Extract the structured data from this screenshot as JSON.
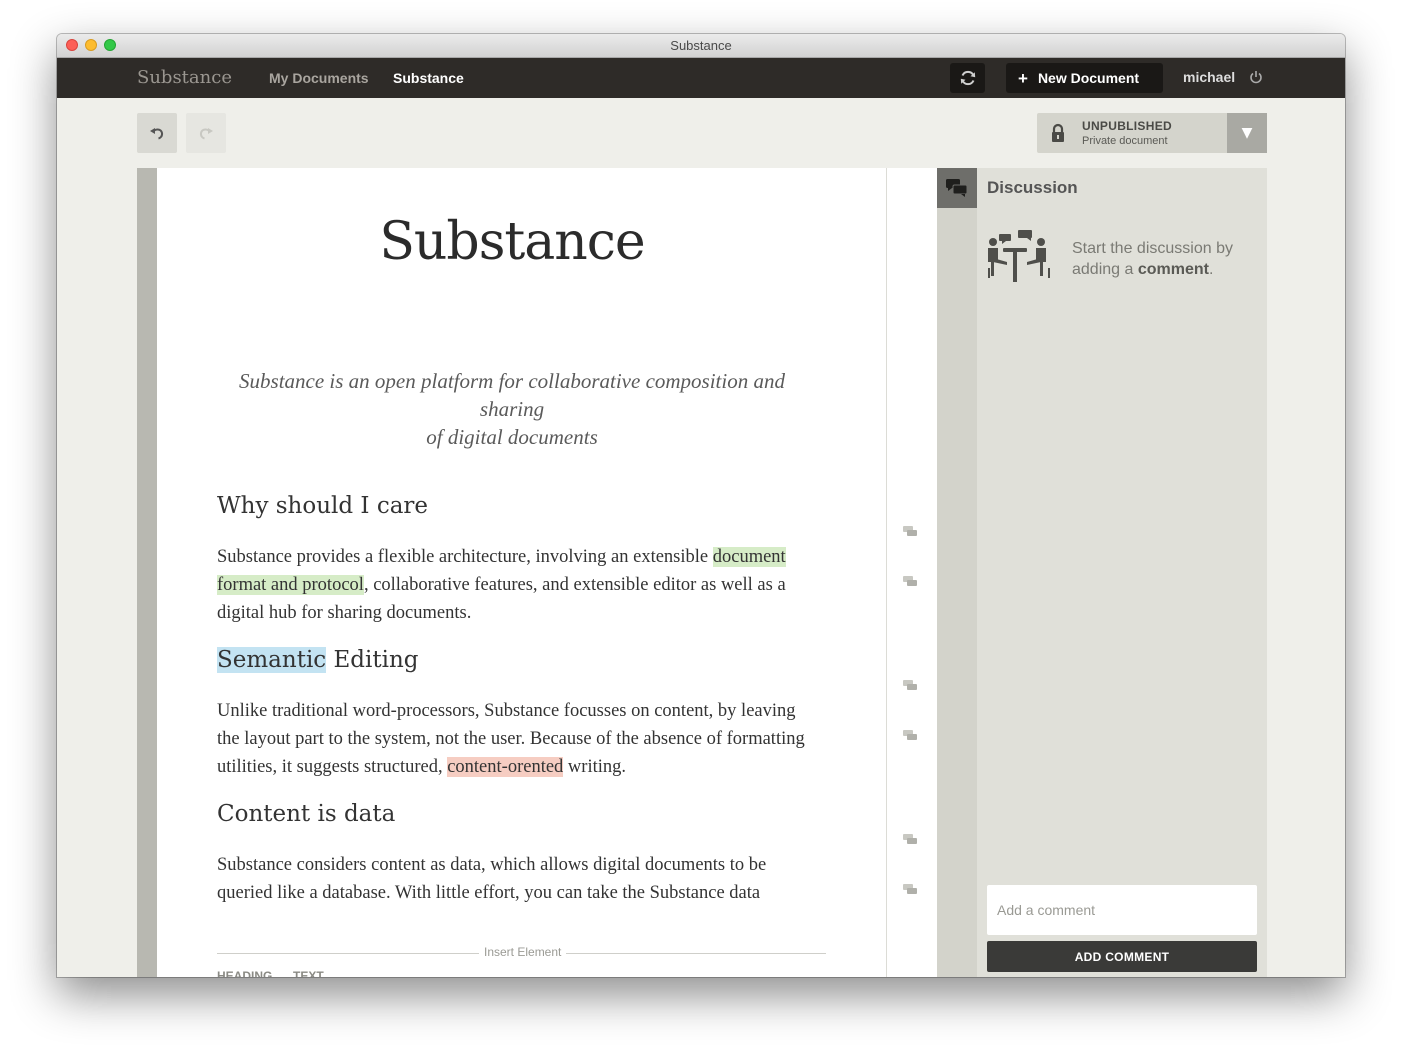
{
  "window": {
    "title": "Substance"
  },
  "nav": {
    "brand": "Substance",
    "links": [
      "My Documents",
      "Substance"
    ],
    "new_document": "New Document",
    "user": "michael"
  },
  "status": {
    "title": "UNPUBLISHED",
    "subtitle": "Private document"
  },
  "document": {
    "title": "Substance",
    "lead_line1": "Substance is an open platform for collaborative composition and sharing",
    "lead_line2": "of digital documents",
    "sections": [
      {
        "heading": "Why should I care",
        "para_before": "Substance provides a flexible architecture, involving an extensible ",
        "para_highlight": "document format and protocol",
        "para_after": ", collaborative features, and extensible editor as well as a digital hub for sharing documents."
      },
      {
        "heading_highlight": "Semantic",
        "heading_rest": " Editing",
        "para_before": "Unlike traditional word-processors, Substance focusses on content, by leaving the layout part to the system, not the user. Because of the absence of formatting utilities, it suggests structured, ",
        "para_highlight": "content-orented",
        "para_after": " writing."
      },
      {
        "heading": "Content is data",
        "para": "Substance considers content as data, which allows digital documents to be queried like a database. With little effort, you can take the Substance data"
      }
    ],
    "insert_element": "Insert Element",
    "insert_options": [
      "HEADING",
      "TEXT"
    ]
  },
  "discussion": {
    "title": "Discussion",
    "hint_prefix": "Start the discussion by adding a ",
    "hint_bold": "comment",
    "hint_suffix": ".",
    "input_placeholder": "Add a comment",
    "add_button": "ADD COMMENT"
  },
  "colors": {
    "navbar": "#2e2b28",
    "highlight_green": "#d6ecc7",
    "highlight_blue": "#c3e3f2",
    "highlight_red": "#f6cdc2"
  }
}
